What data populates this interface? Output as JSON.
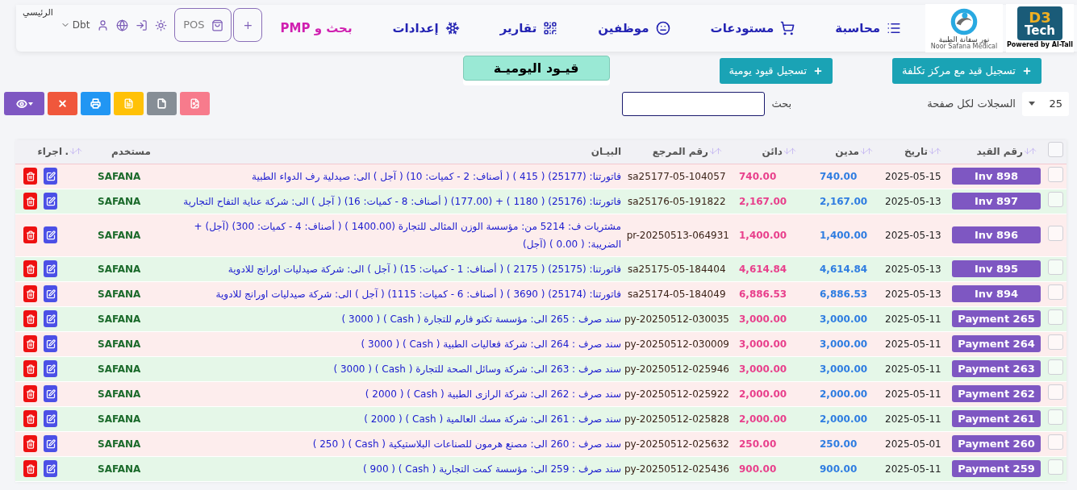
{
  "logos": {
    "brand": {
      "big": "D3",
      "word": "Tech",
      "tagline": "Powered by Al-Tall"
    },
    "client": {
      "arabic": "نور سفانة الطبية",
      "latin": "Noor Safana Medical"
    }
  },
  "menu": [
    {
      "label": "محاسبة",
      "kind": "link"
    },
    {
      "label": "مستودعات",
      "kind": "link"
    },
    {
      "label": "موظفين",
      "kind": "link"
    },
    {
      "label": "تقارير",
      "kind": "link"
    },
    {
      "label": "إعدادات",
      "kind": "link"
    },
    {
      "label": "بحث و PMP",
      "kind": "highlight"
    }
  ],
  "nav_actions": {
    "add": "+",
    "pos": "POS",
    "user": "Dbt",
    "home": "الرئيسي"
  },
  "page_title": "قيـود اليوميـة",
  "buttons": [
    "تسجيل قيد مع مركز تكلفة",
    "تسجيل قيود يومية"
  ],
  "toolbar": {
    "page_size": "25",
    "page_size_label": "السجلات لكل صفحة",
    "search_label": "بحث"
  },
  "table": {
    "select_all_checked": false,
    "columns": [
      {
        "label": "رقم القيد",
        "sortable": true
      },
      {
        "label": "تاريخ",
        "sortable": true
      },
      {
        "label": "مدين",
        "sortable": true
      },
      {
        "label": "دائن",
        "sortable": true
      },
      {
        "label": "رقم المرجع",
        "sortable": true
      },
      {
        "label": "البيـان",
        "sortable": false
      },
      {
        "label": "مستخدم",
        "sortable": false
      },
      {
        "label": ".",
        "sortable": true
      },
      {
        "label": "اجراء",
        "sortable": false
      }
    ],
    "rows": [
      {
        "id": "Inv 898",
        "date": "2025-05-15",
        "debit": "740.00",
        "credit": "740.00",
        "ref": "sa25177-05-104057",
        "desc": "فاتورتنا: (25177) ( 415 ) ( أصناف: 2 - كميات: 10) ( آجل ) الى: صيدلية رف الدواء الطبية",
        "user": "SAFANA",
        "checked": false
      },
      {
        "id": "Inv 897",
        "date": "2025-05-13",
        "debit": "2,167.00",
        "credit": "2,167.00",
        "ref": "sa25176-05-191822",
        "desc": "فاتورتنا: (25176) ( 1180 ) + (177.00) ( أصناف: 8 - كميات: 16) ( آجل ) الى: شركة عناية التفاح التجارية",
        "user": "SAFANA",
        "checked": false
      },
      {
        "id": "Inv 896",
        "date": "2025-05-13",
        "debit": "1,400.00",
        "credit": "1,400.00",
        "ref": "pr-20250513-064931",
        "desc": "مشتريات ف: 5214 من: مؤسسة الوزن المثالى للتجارة (1400.00 ) ( أصناف: 4 - كميات: 300) (آجل) + الضريبة: ( 0.00 ) (آجل)",
        "user": "SAFANA",
        "checked": false
      },
      {
        "id": "Inv 895",
        "date": "2025-05-13",
        "debit": "4,614.84",
        "credit": "4,614.84",
        "ref": "sa25175-05-184404",
        "desc": "فاتورتنا: (25175) ( 2175 ) ( أصناف: 1 - كميات: 15) ( آجل ) الى: شركة صيدليات اورانج للادوية",
        "user": "SAFANA",
        "checked": false
      },
      {
        "id": "Inv 894",
        "date": "2025-05-13",
        "debit": "6,886.53",
        "credit": "6,886.53",
        "ref": "sa25174-05-184049",
        "desc": "فاتورتنا: (25174) ( 3690 ) ( أصناف: 6 - كميات: 1115) ( آجل ) الى: شركة صيدليات اورانج للادوية",
        "user": "SAFANA",
        "checked": false
      },
      {
        "id": "Payment 265",
        "date": "2025-05-11",
        "debit": "3,000.00",
        "credit": "3,000.00",
        "ref": "py-20250512-030035",
        "desc": "سند صرف : 265 الى: مؤسسة تكنو فارم للتجارة ( Cash ) ( 3000 )",
        "user": "SAFANA",
        "checked": false
      },
      {
        "id": "Payment 264",
        "date": "2025-05-11",
        "debit": "3,000.00",
        "credit": "3,000.00",
        "ref": "py-20250512-030009",
        "desc": "سند صرف : 264 الى: شركة فعاليات الطبية ( Cash ) ( 3000 )",
        "user": "SAFANA",
        "checked": false
      },
      {
        "id": "Payment 263",
        "date": "2025-05-11",
        "debit": "3,000.00",
        "credit": "3,000.00",
        "ref": "py-20250512-025946",
        "desc": "سند صرف : 263 الى: شركة وسائل الصحة للتجارة ( Cash ) ( 3000 )",
        "user": "SAFANA",
        "checked": false
      },
      {
        "id": "Payment 262",
        "date": "2025-05-11",
        "debit": "2,000.00",
        "credit": "2,000.00",
        "ref": "py-20250512-025922",
        "desc": "سند صرف : 262 الى: شركة الرازى الطبية ( Cash ) ( 2000 )",
        "user": "SAFANA",
        "checked": false
      },
      {
        "id": "Payment 261",
        "date": "2025-05-11",
        "debit": "2,000.00",
        "credit": "2,000.00",
        "ref": "py-20250512-025828",
        "desc": "سند صرف : 261 الى: شركة مسك العالمية ( Cash ) ( 2000 )",
        "user": "SAFANA",
        "checked": false
      },
      {
        "id": "Payment 260",
        "date": "2025-05-01",
        "debit": "250.00",
        "credit": "250.00",
        "ref": "py-20250512-025632",
        "desc": "سند صرف : 260 الى: مصنع هرمون للصناعات البلاستيكية ( Cash ) ( 250 )",
        "user": "SAFANA",
        "checked": false
      },
      {
        "id": "Payment 259",
        "date": "2025-05-11",
        "debit": "900.00",
        "credit": "900.00",
        "ref": "py-20250512-025436",
        "desc": "سند صرف : 259 الى: مؤسسة كمت التجارية ( Cash ) ( 900 )",
        "user": "SAFANA",
        "checked": false
      }
    ]
  }
}
